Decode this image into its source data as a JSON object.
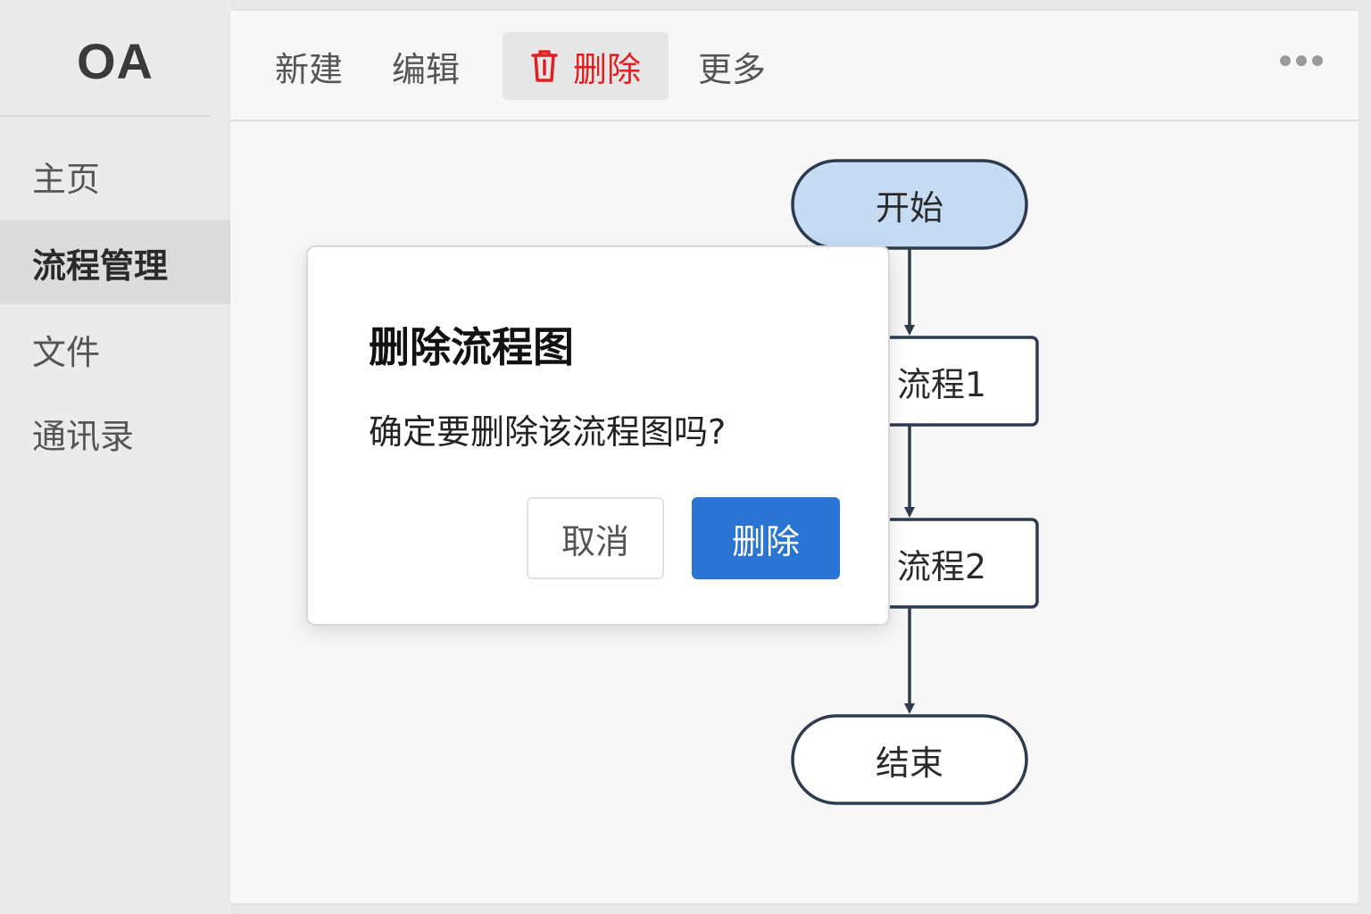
{
  "app": {
    "logo": "OA"
  },
  "sidebar": {
    "items": [
      {
        "label": "主页",
        "active": false
      },
      {
        "label": "流程管理",
        "active": true
      },
      {
        "label": "文件",
        "active": false
      },
      {
        "label": "通讯录",
        "active": false
      }
    ]
  },
  "toolbar": {
    "new_label": "新建",
    "edit_label": "编辑",
    "delete_label": "删除",
    "more_label": "更多",
    "delete_icon": "trash-icon",
    "overflow_icon": "more-horizontal-icon",
    "delete_color": "#e02020"
  },
  "flowchart": {
    "nodes": [
      {
        "id": "start",
        "label": "开始",
        "shape": "terminal"
      },
      {
        "id": "step1",
        "label": "流程1",
        "shape": "process"
      },
      {
        "id": "step2",
        "label": "流程2",
        "shape": "process"
      },
      {
        "id": "end",
        "label": "结束",
        "shape": "terminal"
      }
    ],
    "start_fill": "#c6dcf3",
    "stroke": "#2d3a4f"
  },
  "dialog": {
    "title": "删除流程图",
    "message": "确定要删除该流程图吗?",
    "cancel_label": "取消",
    "confirm_label": "删除",
    "confirm_color": "#2a74d4"
  }
}
